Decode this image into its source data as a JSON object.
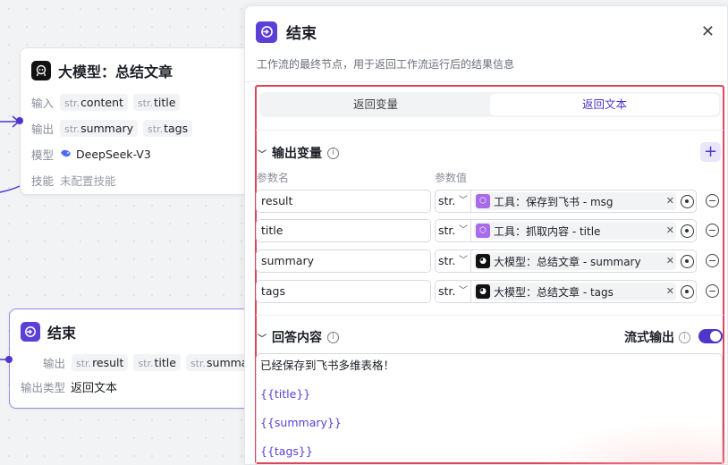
{
  "llm_node": {
    "title": "大模型：总结文章",
    "input_label": "输入",
    "inputs": [
      {
        "type": "str.",
        "name": "content"
      },
      {
        "type": "str.",
        "name": "title"
      }
    ],
    "output_label": "输出",
    "outputs": [
      {
        "type": "str.",
        "name": "summary"
      },
      {
        "type": "str.",
        "name": "tags"
      }
    ],
    "model_label": "模型",
    "model_value": "DeepSeek-V3",
    "skill_label": "技能",
    "skill_value": "未配置技能"
  },
  "end_node": {
    "title": "结束",
    "output_label": "输出",
    "outputs": [
      {
        "type": "str.",
        "name": "result"
      },
      {
        "type": "str.",
        "name": "title"
      },
      {
        "type": "str.",
        "name": "summary"
      }
    ],
    "output_type_label": "输出类型",
    "output_type_value": "返回文本"
  },
  "panel": {
    "title": "结束",
    "description": "工作流的最终节点，用于返回工作流运行后的结果信息",
    "tabs": [
      {
        "label": "返回变量",
        "active": false
      },
      {
        "label": "返回文本",
        "active": true
      }
    ],
    "output_section": {
      "title": "输出变量",
      "col_param_name": "参数名",
      "col_param_value": "参数值",
      "rows": [
        {
          "name": "result",
          "type": "str.",
          "ref_icon": "tool-icon",
          "ref_text": "工具：保存到飞书 - msg"
        },
        {
          "name": "title",
          "type": "str.",
          "ref_icon": "tool-icon",
          "ref_text": "工具：抓取内容 - title"
        },
        {
          "name": "summary",
          "type": "str.",
          "ref_icon": "llm-icon",
          "ref_text": "大模型：总结文章 - summary"
        },
        {
          "name": "tags",
          "type": "str.",
          "ref_icon": "llm-icon",
          "ref_text": "大模型：总结文章 - tags"
        }
      ]
    },
    "answer_section": {
      "title": "回答内容",
      "stream_label": "流式输出",
      "stream_enabled": true,
      "lines": [
        "已经保存到飞书多维表格！",
        "{{title}}",
        "{{summary}}",
        "{{tags}}"
      ]
    }
  },
  "colors": {
    "accent": "#4d36c9",
    "highlight_frame": "#e0455c",
    "tool_icon": "#a86be8"
  }
}
